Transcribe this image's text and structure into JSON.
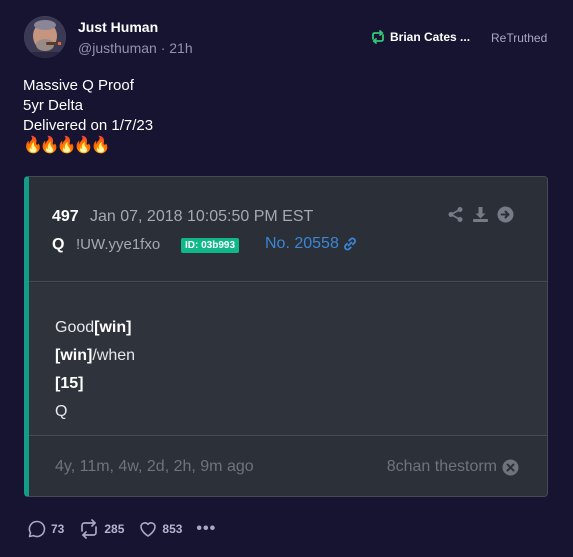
{
  "author": {
    "display_name": "Just Human",
    "handle": "@justhuman",
    "time": "21h"
  },
  "retruth": {
    "user": "Brian Cates ...",
    "label": "ReTruthed"
  },
  "post_text": {
    "line1": "Massive Q Proof",
    "line2": "5yr Delta",
    "line3": "Delivered on 1/7/23",
    "emoji": "🔥🔥🔥🔥🔥"
  },
  "embed": {
    "post_number": "497",
    "date": "Jan 07, 2018 10:05:50 PM EST",
    "poster": "Q",
    "tripcode": "!UW.yye1fxo",
    "id_badge": "ID: 03b993",
    "post_no": "No. 20558",
    "body": {
      "l1a": "Good",
      "l1b": "[win]",
      "l2a": "[win]",
      "l2b": "/when",
      "l3": "[15]",
      "l4": "Q"
    },
    "time_ago": "4y, 11m, 4w, 2d, 2h, 9m ago",
    "board": "8chan thestorm"
  },
  "actions": {
    "replies": "73",
    "retruths": "285",
    "likes": "853",
    "more": "•••"
  },
  "colors": {
    "background": "#161431",
    "accent_teal": "#139c86",
    "id_badge": "#10b788",
    "link_blue": "#3a86d8",
    "retruth_green": "#33c87a"
  }
}
